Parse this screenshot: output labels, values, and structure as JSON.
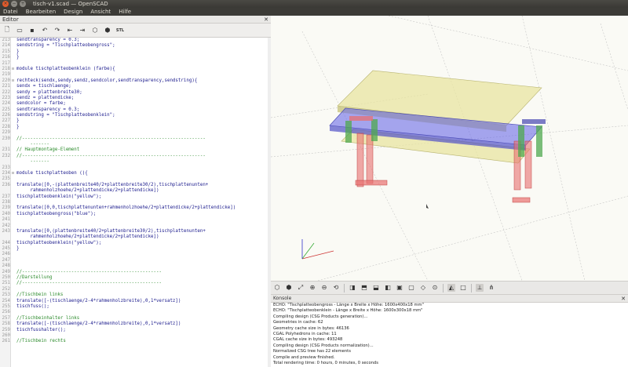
{
  "window": {
    "title": "tisch-v1.scad — OpenSCAD",
    "close_glyph": "×",
    "min_glyph": "−",
    "max_glyph": "+"
  },
  "menu": [
    "Datei",
    "Bearbeiten",
    "Design",
    "Ansicht",
    "Hilfe"
  ],
  "editor": {
    "title": "Editor",
    "toolbar": [
      "new-file-icon",
      "open-file-icon",
      "save-icon",
      "undo-icon",
      "redo-icon",
      "unindent-icon",
      "indent-icon",
      "preview-icon",
      "render-icon",
      "export-stl-icon"
    ],
    "toolbar_stl_label": "STL",
    "lines": [
      {
        "n": "213",
        "t": "sendtransparency = 0.3;",
        "k": "s",
        "f": ""
      },
      {
        "n": "214",
        "t": "sendstring = \"Tischplatteobengross\";",
        "k": "s",
        "f": ""
      },
      {
        "n": "215",
        "t": "}",
        "k": "s",
        "f": ""
      },
      {
        "n": "216",
        "t": "}",
        "k": "s",
        "f": ""
      },
      {
        "n": "217",
        "t": "",
        "k": "s",
        "f": ""
      },
      {
        "n": "218",
        "t": "module tischplatteobenklein (farbe){",
        "k": "s",
        "f": "⊟"
      },
      {
        "n": "219",
        "t": "",
        "k": "s",
        "f": ""
      },
      {
        "n": "220",
        "t": "rechteck(sendx,sendy,sendz,sendcolor,sendtransparency,sendstring){",
        "k": "s",
        "f": "⊟"
      },
      {
        "n": "221",
        "t": "sendx = tischlaenge;",
        "k": "s",
        "f": ""
      },
      {
        "n": "222",
        "t": "sendy = plattenbreite30;",
        "k": "s",
        "f": ""
      },
      {
        "n": "223",
        "t": "sendz = plattendicke;",
        "k": "s",
        "f": ""
      },
      {
        "n": "224",
        "t": "sendcolor = farbe;",
        "k": "s",
        "f": ""
      },
      {
        "n": "225",
        "t": "sendtransparency = 0.3;",
        "k": "s",
        "f": ""
      },
      {
        "n": "226",
        "t": "sendstring = \"Tischplatteobenklein\";",
        "k": "s",
        "f": ""
      },
      {
        "n": "227",
        "t": "}",
        "k": "s",
        "f": ""
      },
      {
        "n": "228",
        "t": "}",
        "k": "s",
        "f": ""
      },
      {
        "n": "229",
        "t": "",
        "k": "s",
        "f": ""
      },
      {
        "n": "230",
        "t": "//-------------------------------------------------------------------",
        "k": "c",
        "f": ""
      },
      {
        "n": "",
        "t": "     -------",
        "k": "c",
        "f": ""
      },
      {
        "n": "231",
        "t": "// Hauptmontage-Element",
        "k": "c",
        "f": ""
      },
      {
        "n": "232",
        "t": "//-------------------------------------------------------------------",
        "k": "c",
        "f": ""
      },
      {
        "n": "",
        "t": "     -------",
        "k": "c",
        "f": ""
      },
      {
        "n": "233",
        "t": "",
        "k": "s",
        "f": ""
      },
      {
        "n": "234",
        "t": "module tischplatteoben (){",
        "k": "s",
        "f": "⊟"
      },
      {
        "n": "235",
        "t": "",
        "k": "s",
        "f": ""
      },
      {
        "n": "236",
        "t": "translate([0,-(plattenbreite40/2+plattenbreite30/2),tischplattenunten+",
        "k": "s",
        "f": ""
      },
      {
        "n": "",
        "t": "     rahmenholzhoehe/2+plattendicke/2+plattendicke])",
        "k": "s",
        "f": ""
      },
      {
        "n": "237",
        "t": "tischplatteobenklein(\"yellow\");",
        "k": "s",
        "f": ""
      },
      {
        "n": "238",
        "t": "",
        "k": "s",
        "f": ""
      },
      {
        "n": "239",
        "t": "translate([0,0,tischplattenunten+rahmenholzhoehe/2+plattendicke/2+plattendicke])",
        "k": "s",
        "f": ""
      },
      {
        "n": "240",
        "t": "tischplatteobengross(\"blue\");",
        "k": "s",
        "f": ""
      },
      {
        "n": "241",
        "t": "",
        "k": "s",
        "f": ""
      },
      {
        "n": "242",
        "t": "",
        "k": "s",
        "f": ""
      },
      {
        "n": "243",
        "t": "translate([0,(plattenbreite40/2+plattenbreite30/2),tischplattenunten+",
        "k": "s",
        "f": ""
      },
      {
        "n": "",
        "t": "     rahmenholzhoehe/2+plattendicke/2+plattendicke])",
        "k": "s",
        "f": ""
      },
      {
        "n": "244",
        "t": "tischplatteobenklein(\"yellow\");",
        "k": "s",
        "f": ""
      },
      {
        "n": "245",
        "t": "}",
        "k": "s",
        "f": ""
      },
      {
        "n": "246",
        "t": "",
        "k": "s",
        "f": ""
      },
      {
        "n": "247",
        "t": "",
        "k": "s",
        "f": ""
      },
      {
        "n": "248",
        "t": "",
        "k": "s",
        "f": ""
      },
      {
        "n": "249",
        "t": "//---------------------------------------------------",
        "k": "c",
        "f": ""
      },
      {
        "n": "250",
        "t": "//Darstellung",
        "k": "c",
        "f": ""
      },
      {
        "n": "251",
        "t": "//---------------------------------------------------",
        "k": "c",
        "f": ""
      },
      {
        "n": "252",
        "t": "",
        "k": "s",
        "f": ""
      },
      {
        "n": "253",
        "t": "//Tischbein links",
        "k": "c",
        "f": ""
      },
      {
        "n": "254",
        "t": "translate([-(tischlaenge/2-4*rahmenholzbreite),0,1*versatz])",
        "k": "s",
        "f": ""
      },
      {
        "n": "255",
        "t": "tischfuss();",
        "k": "s",
        "f": ""
      },
      {
        "n": "256",
        "t": "",
        "k": "s",
        "f": ""
      },
      {
        "n": "257",
        "t": "//Tischbeinhalter links",
        "k": "c",
        "f": ""
      },
      {
        "n": "258",
        "t": "translate([-(tischlaenge/2-4*rahmenholzbreite),0,1*versatz])",
        "k": "s",
        "f": ""
      },
      {
        "n": "259",
        "t": "tischfusshalter();",
        "k": "s",
        "f": ""
      },
      {
        "n": "260",
        "t": "",
        "k": "s",
        "f": ""
      },
      {
        "n": "261",
        "t": "//Tischbein rechts",
        "k": "c",
        "f": ""
      }
    ]
  },
  "view_toolbar": [
    "preview-icon",
    "render-icon",
    "zoom-all-icon",
    "zoom-in-icon",
    "zoom-out-icon",
    "reset-view-icon",
    "sep",
    "view-right-icon",
    "view-top-icon",
    "view-bottom-icon",
    "view-left-icon",
    "view-front-icon",
    "view-back-icon",
    "view-diagonal-icon",
    "view-center-icon",
    "sep",
    "perspective-icon",
    "orthogonal-icon",
    "sep",
    "show-axes-icon",
    "show-edges-icon"
  ],
  "console": {
    "title": "Konsole",
    "lines": [
      "ECHO: \"Tischplatteobengross - Länge x Breite x Höhe: 1600x400x18 mm\"",
      "ECHO: \"Tischplatteobenklein - Länge x Breite x Höhe: 1600x300x18 mm\"",
      "Compiling design (CSG Products generation)...",
      "Geometries in cache: 62",
      "Geometry cache size in bytes: 46136",
      "CGAL Polyhedrons in cache: 11",
      "CGAL cache size in bytes: 493248",
      "Compiling design (CSG Products normalization)...",
      "Normalized CSG tree has 22 elements",
      "Compile and preview finished.",
      "Total rendering time: 0 hours, 0 minutes, 0 seconds"
    ]
  },
  "colors": {
    "yellow_plate": "#e8e4a0",
    "blue_plate": "#6a6ae8",
    "red_leg": "#e87070",
    "green_holder": "#4fa84f"
  }
}
